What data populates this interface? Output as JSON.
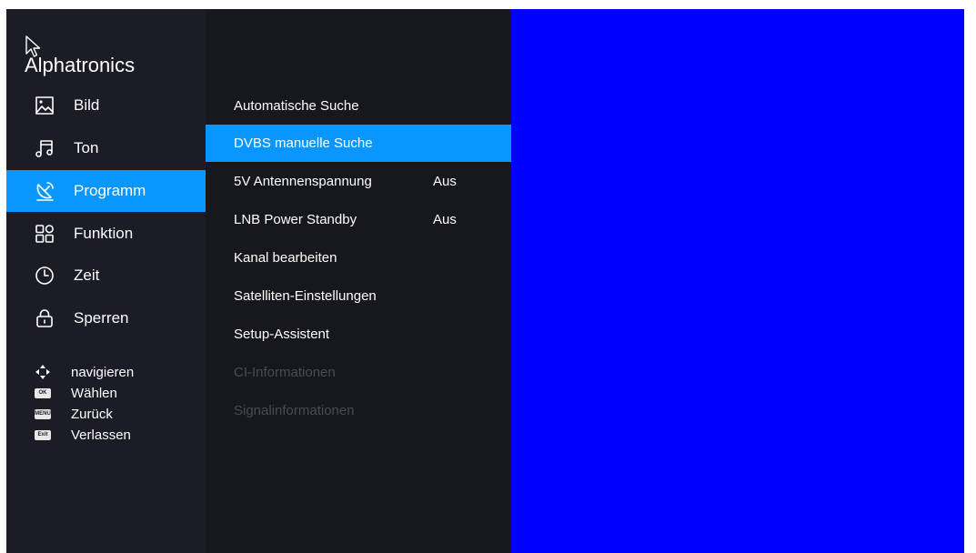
{
  "brand": {
    "title": "Alphatronics"
  },
  "sidebar": {
    "items": [
      {
        "label": "Bild",
        "icon": "picture-icon",
        "active": false
      },
      {
        "label": "Ton",
        "icon": "music-note-icon",
        "active": false
      },
      {
        "label": "Programm",
        "icon": "satellite-dish-icon",
        "active": true
      },
      {
        "label": "Funktion",
        "icon": "grid-icon",
        "active": false
      },
      {
        "label": "Zeit",
        "icon": "clock-icon",
        "active": false
      },
      {
        "label": "Sperren",
        "icon": "lock-icon",
        "active": false
      }
    ]
  },
  "hints": [
    {
      "key": "",
      "icon": "dpad-arrows-icon",
      "label": "navigieren"
    },
    {
      "key": "OK",
      "icon": "ok-key-icon",
      "label": "Wählen"
    },
    {
      "key": "MENU",
      "icon": "menu-key-icon",
      "label": "Zurück"
    },
    {
      "key": "Exit",
      "icon": "exit-key-icon",
      "label": "Verlassen"
    }
  ],
  "submenu": {
    "items": [
      {
        "label": "Automatische Suche",
        "value": "",
        "state": "normal"
      },
      {
        "label": "DVBS manuelle Suche",
        "value": "",
        "state": "active"
      },
      {
        "label": "5V Antennenspannung",
        "value": "Aus",
        "state": "normal"
      },
      {
        "label": "LNB Power Standby",
        "value": "Aus",
        "state": "normal"
      },
      {
        "label": "Kanal bearbeiten",
        "value": "",
        "state": "normal"
      },
      {
        "label": "Satelliten-Einstellungen",
        "value": "",
        "state": "normal"
      },
      {
        "label": "Setup-Assistent",
        "value": "",
        "state": "normal"
      },
      {
        "label": "CI-Informationen",
        "value": "",
        "state": "disabled"
      },
      {
        "label": "Signalinformationen",
        "value": "",
        "state": "disabled"
      }
    ]
  },
  "colors": {
    "accent": "#0a96ff",
    "preview": "#0000ff",
    "sidebar": "#1c1c27",
    "submenu": "#17171e",
    "disabled_text": "#4b4b55"
  }
}
